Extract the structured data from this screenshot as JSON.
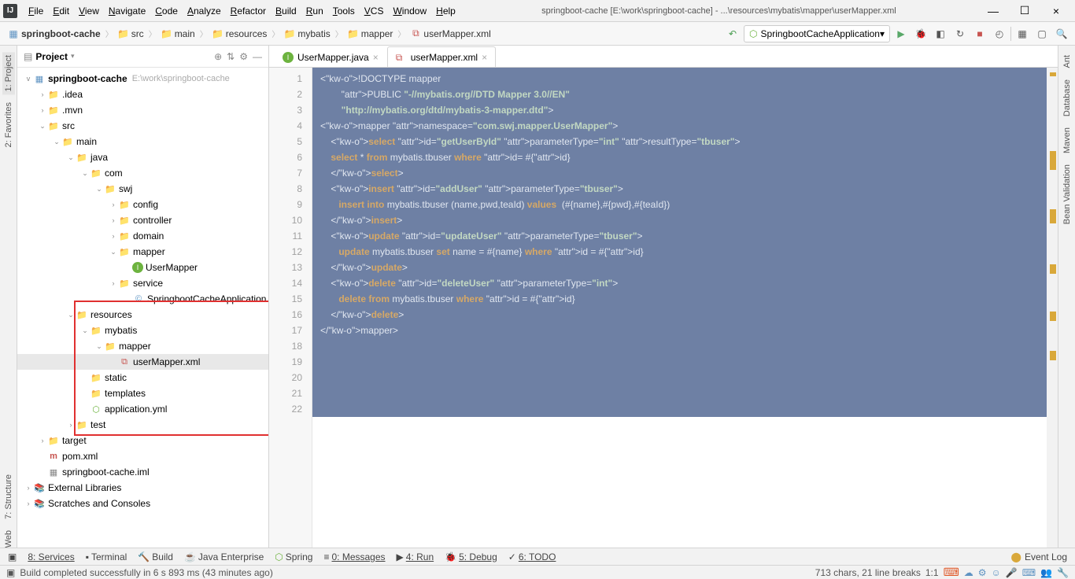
{
  "window": {
    "title": "springboot-cache [E:\\work\\springboot-cache] - ...\\resources\\mybatis\\mapper\\userMapper.xml",
    "minimize": "—",
    "maximize": "☐",
    "close": "×"
  },
  "menus": [
    "File",
    "Edit",
    "View",
    "Navigate",
    "Code",
    "Analyze",
    "Refactor",
    "Build",
    "Run",
    "Tools",
    "VCS",
    "Window",
    "Help"
  ],
  "breadcrumbs": [
    "springboot-cache",
    "src",
    "main",
    "resources",
    "mybatis",
    "mapper",
    "userMapper.xml"
  ],
  "runConfig": {
    "name": "SpringbootCacheApplication",
    "dropdown": "▾"
  },
  "toolbarIcons": [
    "play",
    "bug",
    "coverage",
    "refresh",
    "stop",
    "profile",
    "sep",
    "layout",
    "window",
    "search"
  ],
  "leftGutter": [
    "1: Project",
    "2: Favorites",
    "7: Structure",
    "Web"
  ],
  "rightGutter": [
    "Ant",
    "Database",
    "Maven",
    "Bean Validation"
  ],
  "projectPanel": {
    "title": "Project",
    "dropdown": "▾"
  },
  "tree": {
    "root": {
      "label": "springboot-cache",
      "hint": "E:\\work\\springboot-cache"
    },
    "items": [
      {
        "indent": 1,
        "arrow": "›",
        "ico": "folder",
        "label": ".idea"
      },
      {
        "indent": 1,
        "arrow": "›",
        "ico": "folder",
        "label": ".mvn"
      },
      {
        "indent": 1,
        "arrow": "v",
        "ico": "folder",
        "label": "src"
      },
      {
        "indent": 2,
        "arrow": "v",
        "ico": "folder",
        "label": "main"
      },
      {
        "indent": 3,
        "arrow": "v",
        "ico": "folder-b",
        "label": "java"
      },
      {
        "indent": 4,
        "arrow": "v",
        "ico": "folder",
        "label": "com"
      },
      {
        "indent": 5,
        "arrow": "v",
        "ico": "folder",
        "label": "swj"
      },
      {
        "indent": 6,
        "arrow": "›",
        "ico": "folder",
        "label": "config"
      },
      {
        "indent": 6,
        "arrow": "›",
        "ico": "folder",
        "label": "controller"
      },
      {
        "indent": 6,
        "arrow": "›",
        "ico": "folder",
        "label": "domain"
      },
      {
        "indent": 6,
        "arrow": "v",
        "ico": "folder",
        "label": "mapper"
      },
      {
        "indent": 7,
        "arrow": " ",
        "ico": "interface",
        "label": "UserMapper"
      },
      {
        "indent": 6,
        "arrow": "›",
        "ico": "folder",
        "label": "service"
      },
      {
        "indent": 7,
        "arrow": " ",
        "ico": "class",
        "label": "SpringbootCacheApplication"
      },
      {
        "indent": 3,
        "arrow": "v",
        "ico": "folder-y",
        "label": "resources"
      },
      {
        "indent": 4,
        "arrow": "v",
        "ico": "folder",
        "label": "mybatis"
      },
      {
        "indent": 5,
        "arrow": "v",
        "ico": "folder",
        "label": "mapper"
      },
      {
        "indent": 6,
        "arrow": " ",
        "ico": "xml",
        "label": "userMapper.xml",
        "selected": true
      },
      {
        "indent": 4,
        "arrow": " ",
        "ico": "folder",
        "label": "static"
      },
      {
        "indent": 4,
        "arrow": " ",
        "ico": "folder",
        "label": "templates"
      },
      {
        "indent": 4,
        "arrow": " ",
        "ico": "yml",
        "label": "application.yml"
      },
      {
        "indent": 3,
        "arrow": "›",
        "ico": "folder",
        "label": "test"
      },
      {
        "indent": 1,
        "arrow": "›",
        "ico": "folder-o",
        "label": "target"
      },
      {
        "indent": 1,
        "arrow": " ",
        "ico": "maven",
        "label": "pom.xml"
      },
      {
        "indent": 1,
        "arrow": " ",
        "ico": "iml",
        "label": "springboot-cache.iml"
      }
    ],
    "extLibs": "External Libraries",
    "scratches": "Scratches and Consoles"
  },
  "tabs": [
    {
      "label": "UserMapper.java",
      "active": false,
      "icon": "interface"
    },
    {
      "label": "userMapper.xml",
      "active": true,
      "icon": "xml"
    }
  ],
  "code": [
    "<!DOCTYPE mapper",
    "        PUBLIC \"-//mybatis.org//DTD Mapper 3.0//EN\"",
    "        \"http://mybatis.org/dtd/mybatis-3-mapper.dtd\">",
    "<mapper namespace=\"com.swj.mapper.UserMapper\">",
    "",
    "    <select id=\"getUserById\" parameterType=\"int\" resultType=\"tbuser\">",
    "    select * from mybatis.tbuser where id= #{id}",
    "    </select>",
    "",
    "    <insert id=\"addUser\" parameterType=\"tbuser\">",
    "       insert into mybatis.tbuser (name,pwd,teaId) values  (#{name},#{pwd},#{teaId})",
    "",
    "    </insert>",
    "",
    "    <update id=\"updateUser\" parameterType=\"tbuser\">",
    "       update mybatis.tbuser set name = #{name} where id = #{id}",
    "    </update>",
    "",
    "    <delete id=\"deleteUser\" parameterType=\"int\">",
    "       delete from mybatis.tbuser where id = #{id}",
    "    </delete>",
    "</mapper>"
  ],
  "bottomTools": {
    "services": "8: Services",
    "terminal": "Terminal",
    "build": "Build",
    "javaee": "Java Enterprise",
    "spring": "Spring",
    "messages": "0: Messages",
    "run": "4: Run",
    "debug": "5: Debug",
    "todo": "6: TODO",
    "eventlog": "Event Log"
  },
  "status": {
    "msg": "Build completed successfully in 6 s 893 ms (43 minutes ago)",
    "chars": "713 chars, 21 line breaks",
    "pos": "1:1"
  }
}
